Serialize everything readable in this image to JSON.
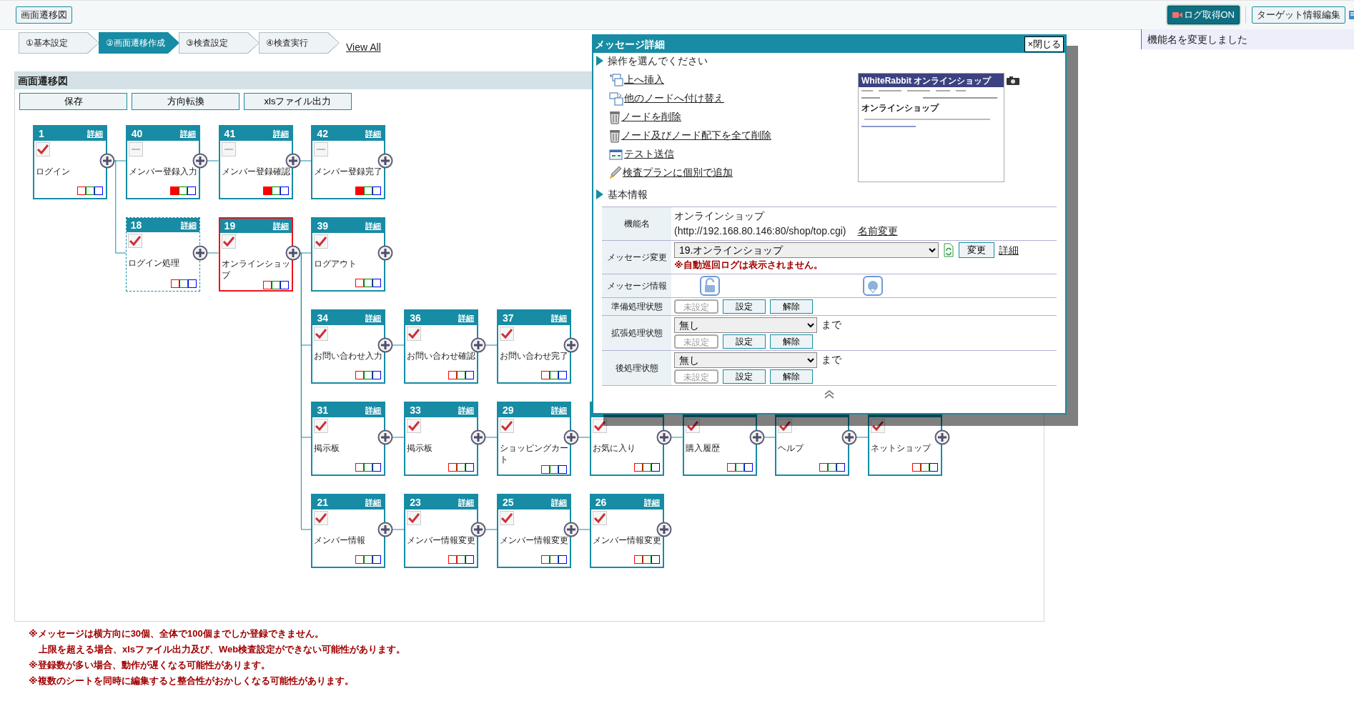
{
  "toolbar": {
    "title_button": "画面遷移図",
    "log_button": "ログ取得ON",
    "target_button": "ターゲット情報編集"
  },
  "toast": "機能名を変更しました",
  "steps": [
    {
      "label": "①基本設定",
      "selected": false
    },
    {
      "label": "②画面遷移作成",
      "selected": true
    },
    {
      "label": "③検査設定",
      "selected": false
    },
    {
      "label": "④検査実行",
      "selected": false
    }
  ],
  "view_all": "View All",
  "panel": {
    "title": "画面遷移図",
    "buttons": [
      "保存",
      "方向転換",
      "xlsファイル出力"
    ]
  },
  "nodes": [
    {
      "number": "1",
      "detail": "詳細",
      "label": "ログイン",
      "checked": true,
      "red_marker": false,
      "dashed": false,
      "selected": false,
      "children": [
        {
          "number": "40",
          "detail": "詳細",
          "label": "メンバー登録入力",
          "checked": false,
          "red_marker": true,
          "dashed": false,
          "selected": false,
          "children": [
            {
              "number": "41",
              "detail": "詳細",
              "label": "メンバー登録確認",
              "checked": false,
              "red_marker": true,
              "dashed": false,
              "selected": false,
              "children": [
                {
                  "number": "42",
                  "detail": "詳細",
                  "label": "メンバー登録完了",
                  "checked": false,
                  "red_marker": true,
                  "dashed": false,
                  "selected": false
                }
              ]
            }
          ]
        },
        {
          "number": "18",
          "detail": "詳細",
          "label": "ログイン処理",
          "checked": true,
          "red_marker": false,
          "dashed": true,
          "selected": false,
          "children": [
            {
              "number": "19",
              "detail": "詳細",
              "label": "オンラインショップ",
              "checked": true,
              "red_marker": false,
              "dashed": false,
              "selected": true,
              "children": [
                {
                  "number": "39",
                  "detail": "詳細",
                  "label": "ログアウト",
                  "checked": true,
                  "red_marker": false,
                  "dashed": false,
                  "selected": false
                },
                {
                  "number": "34",
                  "detail": "詳細",
                  "label": "お問い合わせ入力",
                  "checked": true,
                  "red_marker": false,
                  "dashed": false,
                  "selected": false,
                  "children": [
                    {
                      "number": "36",
                      "detail": "詳細",
                      "label": "お問い合わせ確認",
                      "checked": true,
                      "red_marker": false,
                      "dashed": false,
                      "selected": false,
                      "children": [
                        {
                          "number": "37",
                          "detail": "詳細",
                          "label": "お問い合わせ完了",
                          "checked": true,
                          "red_marker": false,
                          "dashed": false,
                          "selected": false
                        }
                      ]
                    }
                  ]
                },
                {
                  "number": "31",
                  "detail": "詳細",
                  "label": "掲示板",
                  "checked": true,
                  "red_marker": false,
                  "dashed": false,
                  "selected": false,
                  "children": [
                    {
                      "number": "33",
                      "detail": "詳細",
                      "label": "掲示板",
                      "checked": true,
                      "red_marker": false,
                      "dashed": false,
                      "selected": false,
                      "children": [
                        {
                          "number": "29",
                          "detail": "詳細",
                          "label": "ショッピングカート",
                          "checked": true,
                          "red_marker": false,
                          "dashed": false,
                          "selected": false,
                          "children": [
                            {
                              "label": "お気に入り",
                              "checked": true,
                              "red_marker": false,
                              "dashed": false,
                              "selected": false,
                              "children": [
                                {
                                  "label": "購入履歴",
                                  "checked": true,
                                  "red_marker": false,
                                  "dashed": false,
                                  "selected": false,
                                  "children": [
                                    {
                                      "label": "ヘルプ",
                                      "checked": true,
                                      "red_marker": false,
                                      "dashed": false,
                                      "selected": false,
                                      "children": [
                                        {
                                          "label": "ネットショップ",
                                          "checked": true,
                                          "red_marker": false,
                                          "dashed": false,
                                          "selected": false
                                        }
                                      ]
                                    }
                                  ]
                                }
                              ]
                            }
                          ]
                        }
                      ]
                    }
                  ]
                },
                {
                  "number": "21",
                  "detail": "詳細",
                  "label": "メンバー情報",
                  "checked": true,
                  "red_marker": false,
                  "dashed": false,
                  "selected": false,
                  "children": [
                    {
                      "number": "23",
                      "detail": "詳細",
                      "label": "メンバー情報変更",
                      "checked": true,
                      "red_marker": false,
                      "dashed": false,
                      "selected": false,
                      "children": [
                        {
                          "number": "25",
                          "detail": "詳細",
                          "label": "メンバー情報変更",
                          "checked": true,
                          "red_marker": false,
                          "dashed": false,
                          "selected": false,
                          "children": [
                            {
                              "number": "26",
                              "detail": "詳細",
                              "label": "メンバー情報変更",
                              "checked": true,
                              "red_marker": false,
                              "dashed": false,
                              "selected": false
                            }
                          ]
                        }
                      ]
                    }
                  ]
                }
              ]
            }
          ]
        }
      ]
    }
  ],
  "notes": [
    [
      "※メッセージは横方向に30個、全体で100個までしか登録できません。",
      "上限を超える場合、xlsファイル出力及び、Web検査設定ができない可能性があります。"
    ],
    [
      "※登録数が多い場合、動作が遅くなる可能性があります。"
    ],
    [
      "※複数のシートを同時に編集すると整合性がおかしくなる可能性があります。"
    ]
  ],
  "dialog": {
    "title": "メッセージ詳細",
    "close": "×閉じる",
    "ops_heading": "操作を選んでください",
    "operations": [
      {
        "kind": "insert",
        "label": "上へ挿入"
      },
      {
        "kind": "move",
        "label": "他のノードへ付け替え"
      },
      {
        "kind": "delete",
        "label": "ノードを削除"
      },
      {
        "kind": "delete",
        "label": "ノード及びノード配下を全て削除"
      },
      {
        "kind": "send",
        "label": "テスト送信"
      },
      {
        "kind": "plan",
        "label": "検査プランに個別で追加"
      }
    ],
    "thumbnail": {
      "title": "WhiteRabbit オンラインショップ",
      "heading": "オンラインショップ"
    },
    "info_heading": "基本情報",
    "rows": [
      {
        "kind": "name",
        "label": "機能名",
        "name": "オンラインショップ",
        "url": "(http://192.168.80.146:80/shop/top.cgi)",
        "link": "名前変更"
      },
      {
        "kind": "message",
        "label": "メッセージ変更",
        "value": "19.オンラインショップ",
        "button": "変更",
        "link": "詳細",
        "warning": "※自動巡回ログは表示されません。"
      },
      {
        "kind": "icons",
        "label": "メッセージ情報"
      },
      {
        "kind": "state",
        "label": "準備処理状態",
        "status": {
          "label": "未設定",
          "disabled": true
        },
        "set": "設定",
        "clear": "解除"
      },
      {
        "kind": "state",
        "label": "拡張処理状態",
        "select": "無し",
        "until": "まで",
        "status": {
          "label": "未設定",
          "disabled": true
        },
        "set": "設定",
        "clear": "解除"
      },
      {
        "kind": "state",
        "label": "後処理状態",
        "select": "無し",
        "until": "まで",
        "status": {
          "label": "未設定",
          "disabled": true
        },
        "set": "設定",
        "clear": "解除"
      }
    ]
  }
}
